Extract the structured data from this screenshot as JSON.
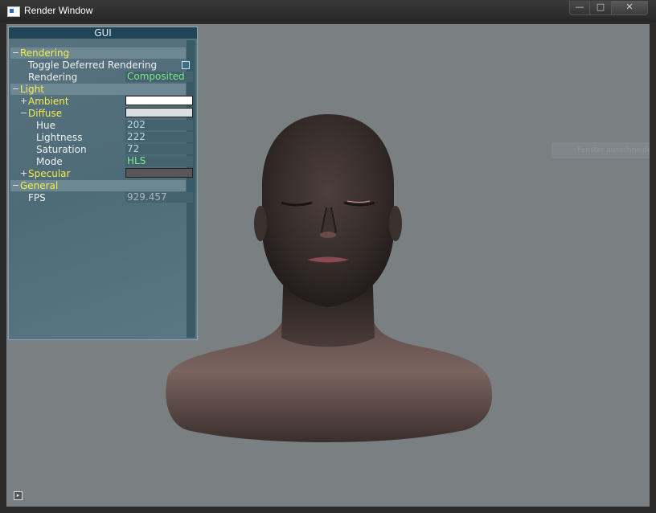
{
  "window": {
    "title": "Render Window",
    "controls": {
      "minimize": "—",
      "maximize": "□",
      "close": "✕"
    }
  },
  "overlay_tooltip": "Fenster ausschneiden",
  "gui": {
    "title": "GUI",
    "rendering": {
      "label": "Rendering",
      "toggle_deferred_label": "Toggle Deferred Rendering",
      "rendering_label": "Rendering",
      "rendering_value": "Composited"
    },
    "light": {
      "label": "Light",
      "ambient_label": "Ambient",
      "ambient_color": "#ffffff",
      "diffuse_label": "Diffuse",
      "diffuse_color": "#d9dee2",
      "hue_label": "Hue",
      "hue_value": "202",
      "lightness_label": "Lightness",
      "lightness_value": "222",
      "saturation_label": "Saturation",
      "saturation_value": "72",
      "mode_label": "Mode",
      "mode_value": "HLS",
      "specular_label": "Specular",
      "specular_color": "#575757"
    },
    "general": {
      "label": "General",
      "fps_label": "FPS",
      "fps_value": "929.457"
    },
    "expanders": {
      "open": "−",
      "closed": "+"
    }
  },
  "colors": {
    "viewport_bg": "#7a8082",
    "skin": "#4a3a36",
    "label_yellow": "#f4ee4a",
    "value_green": "#7de87d"
  }
}
